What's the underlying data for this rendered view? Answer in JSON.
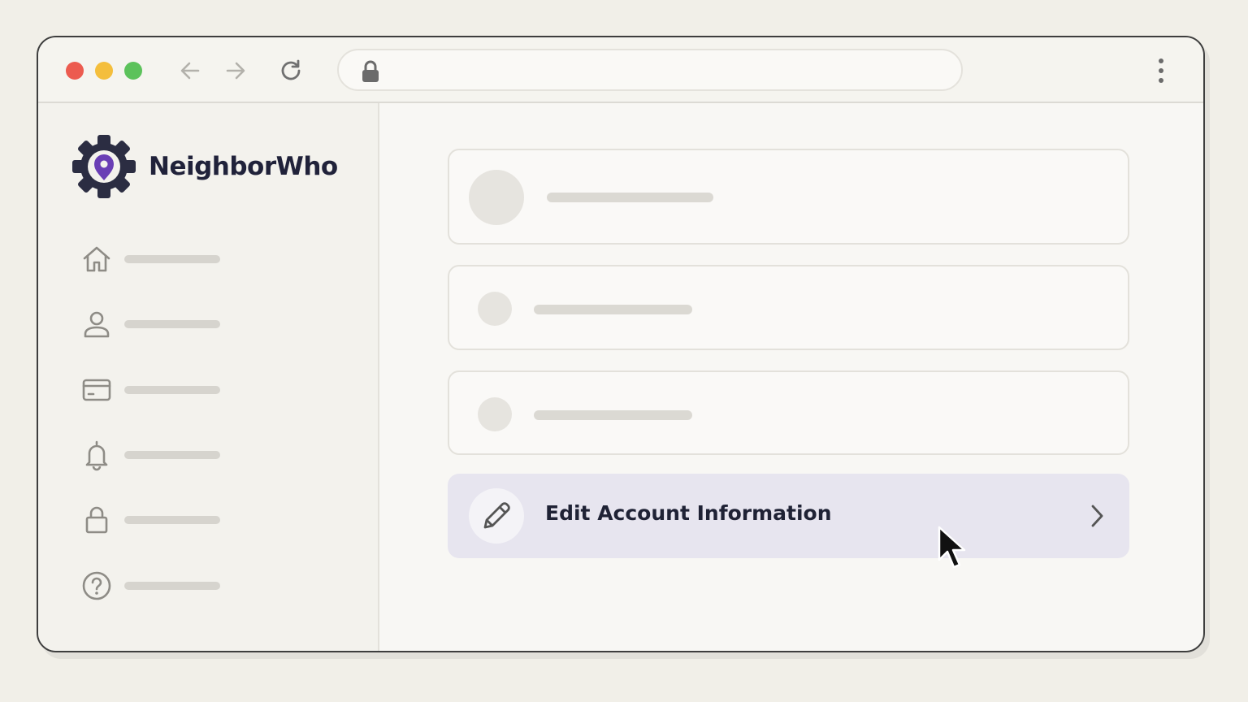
{
  "browser": {
    "controls": [
      "close",
      "minimize",
      "maximize"
    ],
    "nav_icons": [
      "arrow-left-icon",
      "arrow-right-icon",
      "reload-icon"
    ],
    "address_icon": "lock-icon",
    "menu_icon": "kebab-menu-icon"
  },
  "sidebar": {
    "brand": {
      "name": "NeighborWho",
      "logo_icon": "gear-location-pin-icon",
      "logo_colors": {
        "gear": "#2b2d42",
        "pin": "#6a3fb5"
      }
    },
    "items": [
      {
        "icon": "home-icon"
      },
      {
        "icon": "user-icon"
      },
      {
        "icon": "credit-card-icon"
      },
      {
        "icon": "bell-icon"
      },
      {
        "icon": "lock-icon"
      },
      {
        "icon": "help-icon"
      }
    ]
  },
  "main": {
    "edit_account": {
      "label": "Edit Account Information",
      "icon": "pencil-icon",
      "chevron": "chevron-right-icon",
      "highlight_color": "#e7e5ef"
    }
  }
}
